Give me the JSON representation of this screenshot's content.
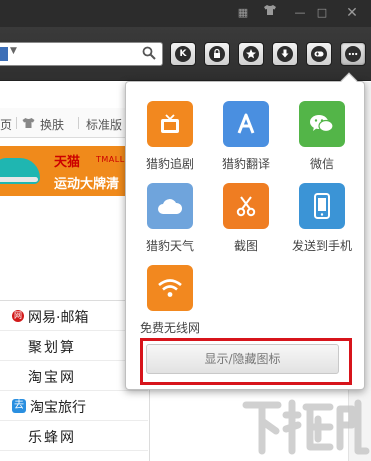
{
  "colors": {
    "titlebar": "#2c2c2c",
    "toolbar": "#343434",
    "highlight": "#d7141b",
    "banner": "#f08a1b",
    "tile_orange": "#f2881f",
    "tile_blue": "#4a8fe0",
    "tile_green": "#53b548",
    "tile_sky": "#6fa4dc",
    "tile_red_orange": "#ef7d22",
    "tile_device_blue": "#3b94d6"
  },
  "window_controls": [
    "grid-icon",
    "skin-icon",
    "minimize-icon",
    "maximize-icon",
    "close-icon"
  ],
  "toolbar_buttons": [
    "k-icon",
    "lock-icon",
    "star-icon",
    "download-icon",
    "gamepad-icon",
    "more-icon"
  ],
  "nav": {
    "item1_partial": "页",
    "item2": "换肤",
    "item3_partial": "标准版"
  },
  "banner": {
    "line1": "天猫",
    "tmall": "TMALL.C",
    "line2": "运动大牌清"
  },
  "sites": [
    {
      "label": "网易·邮箱",
      "icon": "netease-icon"
    },
    {
      "label": "聚划算",
      "icon": ""
    },
    {
      "label": "淘宝网",
      "icon": ""
    },
    {
      "label": "淘宝旅行",
      "icon": "taobao-travel-icon"
    },
    {
      "label": "乐蜂网",
      "icon": ""
    }
  ],
  "popup": {
    "apps": [
      {
        "label": "猎豹追剧",
        "icon": "tv-icon"
      },
      {
        "label": "猎豹翻译",
        "icon": "translate-icon"
      },
      {
        "label": "微信",
        "icon": "wechat-icon"
      },
      {
        "label": "猎豹天气",
        "icon": "weather-icon"
      },
      {
        "label": "截图",
        "icon": "scissors-icon"
      },
      {
        "label": "发送到手机",
        "icon": "phone-icon"
      },
      {
        "label": "免费无线网",
        "icon": "wifi-icon"
      }
    ],
    "toggle_button": "显示/隐藏图标"
  },
  "watermark": "下载吧"
}
